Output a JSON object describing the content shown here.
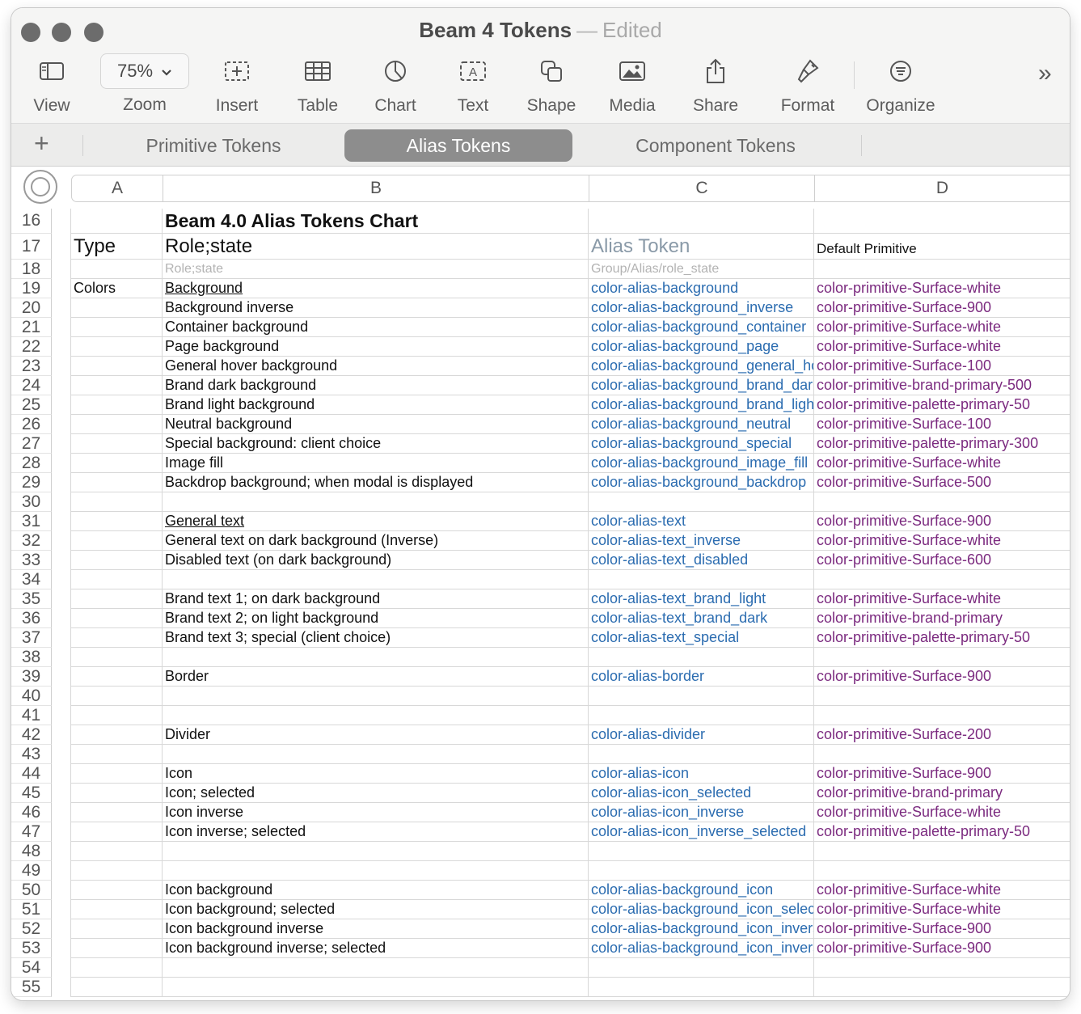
{
  "window": {
    "title": "Beam 4 Tokens",
    "separator": "—",
    "status": "Edited"
  },
  "toolbar": {
    "view": "View",
    "zoom_value": "75%",
    "zoom": "Zoom",
    "insert": "Insert",
    "table": "Table",
    "chart": "Chart",
    "text": "Text",
    "shape": "Shape",
    "media": "Media",
    "share": "Share",
    "format": "Format",
    "organize": "Organize",
    "more": "»"
  },
  "tabs": {
    "add": "+",
    "items": [
      "Primitive Tokens",
      "Alias Tokens",
      "Component Tokens"
    ],
    "active": "Alias Tokens"
  },
  "sheet": {
    "columns": [
      "A",
      "B",
      "C",
      "D"
    ],
    "rows": [
      {
        "n": "16",
        "a": "",
        "b": "Beam 4.0 Alias Tokens Chart",
        "c": "",
        "d": ""
      },
      {
        "n": "17",
        "a": "Type",
        "b": "Role;state",
        "c": "Alias Token",
        "d": "Default Primitive"
      },
      {
        "n": "18",
        "a": "",
        "b": "Role;state",
        "c": "Group/Alias/role_state",
        "d": ""
      },
      {
        "n": "19",
        "a": "Colors",
        "b": "Background",
        "c": "color-alias-background",
        "d": "color-primitive-Surface-white"
      },
      {
        "n": "20",
        "a": "",
        "b": "Background inverse",
        "c": "color-alias-background_inverse",
        "d": "color-primitive-Surface-900"
      },
      {
        "n": "21",
        "a": "",
        "b": "Container background",
        "c": "color-alias-background_container",
        "d": "color-primitive-Surface-white"
      },
      {
        "n": "22",
        "a": "",
        "b": "Page background",
        "c": "color-alias-background_page",
        "d": "color-primitive-Surface-white"
      },
      {
        "n": "23",
        "a": "",
        "b": "General hover background",
        "c": "color-alias-background_general_hc",
        "d": "color-primitive-Surface-100"
      },
      {
        "n": "24",
        "a": "",
        "b": "Brand dark background",
        "c": "color-alias-background_brand_dark",
        "d": "color-primitive-brand-primary-500"
      },
      {
        "n": "25",
        "a": "",
        "b": "Brand light background",
        "c": "color-alias-background_brand_light",
        "d": "color-primitive-palette-primary-50"
      },
      {
        "n": "26",
        "a": "",
        "b": "Neutral background",
        "c": "color-alias-background_neutral",
        "d": "color-primitive-Surface-100"
      },
      {
        "n": "27",
        "a": "",
        "b": "Special background: client choice",
        "c": "color-alias-background_special",
        "d": "color-primitive-palette-primary-300"
      },
      {
        "n": "28",
        "a": "",
        "b": "Image fill",
        "c": "color-alias-background_image_fill",
        "d": "color-primitive-Surface-white"
      },
      {
        "n": "29",
        "a": "",
        "b": "Backdrop background; when modal is displayed",
        "c": "color-alias-background_backdrop",
        "d": "color-primitive-Surface-500"
      },
      {
        "n": "30",
        "a": "",
        "b": "",
        "c": "",
        "d": ""
      },
      {
        "n": "31",
        "a": "",
        "b": "General text",
        "c": "color-alias-text",
        "d": "color-primitive-Surface-900"
      },
      {
        "n": "32",
        "a": "",
        "b": "General text on dark background (Inverse)",
        "c": "color-alias-text_inverse",
        "d": "color-primitive-Surface-white"
      },
      {
        "n": "33",
        "a": "",
        "b": "Disabled text (on dark background)",
        "c": "color-alias-text_disabled",
        "d": "color-primitive-Surface-600"
      },
      {
        "n": "34",
        "a": "",
        "b": "",
        "c": "",
        "d": ""
      },
      {
        "n": "35",
        "a": "",
        "b": "Brand text 1; on dark background",
        "c": "color-alias-text_brand_light",
        "d": "color-primitive-Surface-white"
      },
      {
        "n": "36",
        "a": "",
        "b": "Brand text 2; on light background",
        "c": "color-alias-text_brand_dark",
        "d": "color-primitive-brand-primary"
      },
      {
        "n": "37",
        "a": "",
        "b": "Brand text 3; special (client choice)",
        "c": "color-alias-text_special",
        "d": "color-primitive-palette-primary-50"
      },
      {
        "n": "38",
        "a": "",
        "b": "",
        "c": "",
        "d": ""
      },
      {
        "n": "39",
        "a": "",
        "b": "Border",
        "c": "color-alias-border",
        "d": "color-primitive-Surface-900"
      },
      {
        "n": "40",
        "a": "",
        "b": "",
        "c": "",
        "d": ""
      },
      {
        "n": "41",
        "a": "",
        "b": "",
        "c": "",
        "d": ""
      },
      {
        "n": "42",
        "a": "",
        "b": "Divider",
        "c": "color-alias-divider",
        "d": "color-primitive-Surface-200"
      },
      {
        "n": "43",
        "a": "",
        "b": "",
        "c": "",
        "d": ""
      },
      {
        "n": "44",
        "a": "",
        "b": "Icon",
        "c": "color-alias-icon",
        "d": "color-primitive-Surface-900"
      },
      {
        "n": "45",
        "a": "",
        "b": "Icon; selected",
        "c": "color-alias-icon_selected",
        "d": "color-primitive-brand-primary"
      },
      {
        "n": "46",
        "a": "",
        "b": "Icon inverse",
        "c": "color-alias-icon_inverse",
        "d": "color-primitive-Surface-white"
      },
      {
        "n": "47",
        "a": "",
        "b": "Icon inverse; selected",
        "c": "color-alias-icon_inverse_selected",
        "d": "color-primitive-palette-primary-50"
      },
      {
        "n": "48",
        "a": "",
        "b": "",
        "c": "",
        "d": ""
      },
      {
        "n": "49",
        "a": "",
        "b": "",
        "c": "",
        "d": ""
      },
      {
        "n": "50",
        "a": "",
        "b": "Icon background",
        "c": "color-alias-background_icon",
        "d": "color-primitive-Surface-white"
      },
      {
        "n": "51",
        "a": "",
        "b": "Icon background; selected",
        "c": "color-alias-background_icon_selected",
        "d": "color-primitive-Surface-white"
      },
      {
        "n": "52",
        "a": "",
        "b": "Icon background  inverse",
        "c": "color-alias-background_icon_inverse",
        "d": "color-primitive-Surface-900"
      },
      {
        "n": "53",
        "a": "",
        "b": "Icon background inverse; selected",
        "c": "color-alias-background_icon_inverse_selected",
        "d": "color-primitive-Surface-900"
      },
      {
        "n": "54",
        "a": "",
        "b": "",
        "c": "",
        "d": ""
      },
      {
        "n": "55",
        "a": "",
        "b": "",
        "c": "",
        "d": ""
      }
    ]
  },
  "colors": {
    "alias_text": "#2b6cb0",
    "primitive_text": "#7b2a7f",
    "active_tab": "#8d8d8d"
  }
}
